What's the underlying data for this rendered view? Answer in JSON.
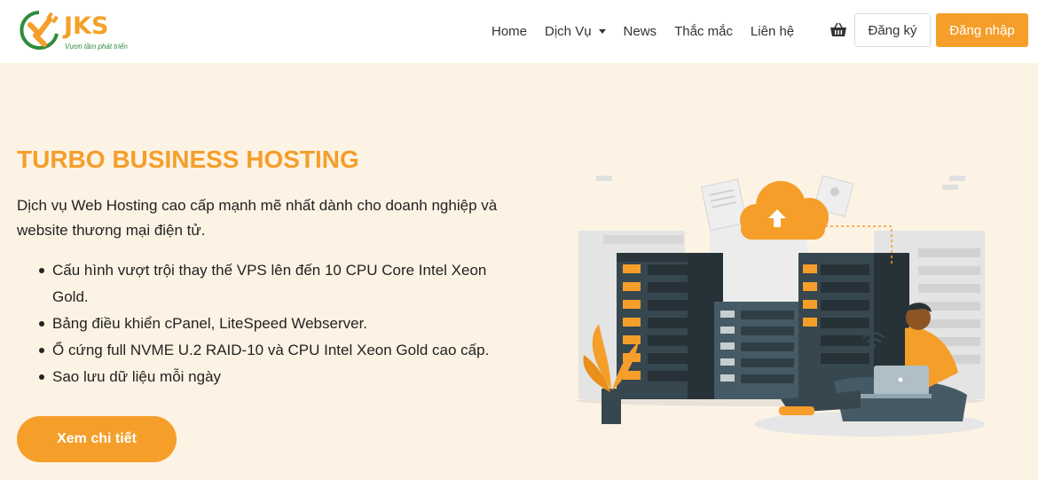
{
  "brand": {
    "name": "JKS",
    "tagline": "Vươn tầm phát triển",
    "colors": {
      "accent": "#f59e2a",
      "green": "#2e8b3c",
      "background": "#fdf3e4"
    }
  },
  "nav": {
    "items": [
      {
        "label": "Home"
      },
      {
        "label": "Dịch Vụ",
        "has_dropdown": true
      },
      {
        "label": "News"
      },
      {
        "label": "Thắc mắc"
      },
      {
        "label": "Liên hệ"
      }
    ],
    "cart_icon": "basket-icon",
    "register_label": "Đăng ký",
    "login_label": "Đăng nhập"
  },
  "hero": {
    "title": "TURBO BUSINESS HOSTING",
    "description": "Dịch vụ Web Hosting cao cấp mạnh mẽ nhất dành cho doanh nghiệp và website thương mại điện tử.",
    "features": [
      "Cấu hình vượt trội thay thế VPS lên đến 10 CPU Core Intel Xeon Gold.",
      "Bảng điều khiển cPanel, LiteSpeed Webserver.",
      "Ổ cứng full NVME U.2 RAID-10 và CPU Intel Xeon Gold cao cấp.",
      "Sao lưu dữ liệu mỗi ngày"
    ],
    "cta_label": "Xem chi tiết",
    "illustration": "server-cloud-illustration"
  }
}
